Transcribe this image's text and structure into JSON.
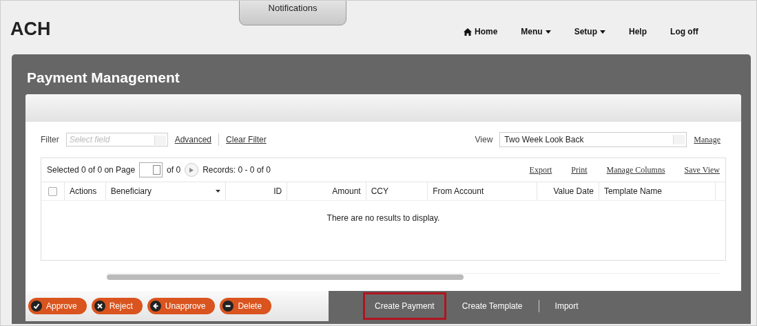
{
  "app": {
    "title": "ACH",
    "notifications_tab": "Notifications"
  },
  "nav": [
    {
      "label": "Home",
      "kind": "home"
    },
    {
      "label": "Menu",
      "kind": "dropdown"
    },
    {
      "label": "Setup",
      "kind": "dropdown"
    },
    {
      "label": "Help",
      "kind": "plain"
    },
    {
      "label": "Log off",
      "kind": "plain"
    }
  ],
  "panel": {
    "title": "Payment Management"
  },
  "filter": {
    "label": "Filter",
    "placeholder": "Select field",
    "links": [
      "Advanced",
      "Clear Filter"
    ]
  },
  "view": {
    "label": "View",
    "value": "Two Week Look Back",
    "link": "Manage"
  },
  "toolbar": {
    "selected_text": "Selected 0 of 0 on Page",
    "page_of": "of 0",
    "records": "Records: 0 - 0 of 0",
    "links": [
      "Export",
      "Print",
      "Manage Columns",
      "Save View"
    ]
  },
  "table": {
    "select_all_checked": false,
    "columns": [
      {
        "label": "Actions",
        "sort": false
      },
      {
        "label": "Beneficiary",
        "sort": true
      },
      {
        "label": "ID",
        "sort": false
      },
      {
        "label": "Amount",
        "sort": false
      },
      {
        "label": "CCY",
        "sort": false
      },
      {
        "label": "From Account",
        "sort": false
      },
      {
        "label": "Value Date",
        "sort": false
      },
      {
        "label": "Template Name",
        "sort": false
      }
    ],
    "empty_message": "There are no results to display."
  },
  "actions": [
    {
      "label": "Approve",
      "kind": "check"
    },
    {
      "label": "Reject",
      "kind": "cross"
    },
    {
      "label": "Unapprove",
      "kind": "back"
    },
    {
      "label": "Delete",
      "kind": "minus"
    }
  ],
  "links": [
    {
      "label": "Create Payment",
      "highlighted": true
    },
    {
      "label": "Create Template",
      "highlighted": false
    },
    {
      "label": "Import",
      "highlighted": false
    }
  ]
}
